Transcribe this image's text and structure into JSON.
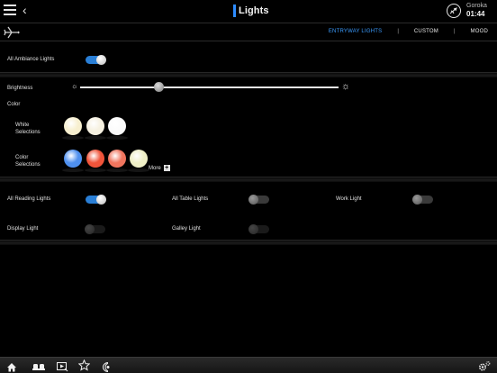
{
  "header": {
    "title": "Lights",
    "destination": "Goroka",
    "time": "01:44"
  },
  "tabs": [
    {
      "label": "ENTRYWAY LIGHTS",
      "active": true
    },
    {
      "label": "CUSTOM",
      "active": false
    },
    {
      "label": "MOOD",
      "active": false
    }
  ],
  "tab_separator": "|",
  "ambiance": {
    "label": "All Ambiance Lights",
    "on": true
  },
  "brightness": {
    "label": "Brightness",
    "level": 0.3
  },
  "color": {
    "label": "Color",
    "white_label": "White Selections",
    "color_label": "Color Selections",
    "more_label": "More",
    "white_swatches": [
      "#f7efcf",
      "#f6f1e1",
      "#fbfbfb"
    ],
    "color_swatches": [
      "#4f90ef",
      "#f0543a",
      "#f0755e",
      "#efefc6"
    ]
  },
  "reading": [
    {
      "label": "All Reading Lights",
      "on": true
    },
    {
      "label": "All Table Lights",
      "on": false
    },
    {
      "label": "Work Light",
      "on": false
    },
    {
      "label": "Display Light",
      "on": false
    },
    {
      "label": "Galley Light",
      "on": false
    }
  ],
  "colors": {
    "accent": "#3b9cff",
    "toggle_on": "#2a7fd6",
    "background": "#000000"
  },
  "bottom_icons": [
    "home-icon",
    "seat-icon",
    "media-icon",
    "favorites-star-icon",
    "audio-icon",
    "settings-icon"
  ]
}
